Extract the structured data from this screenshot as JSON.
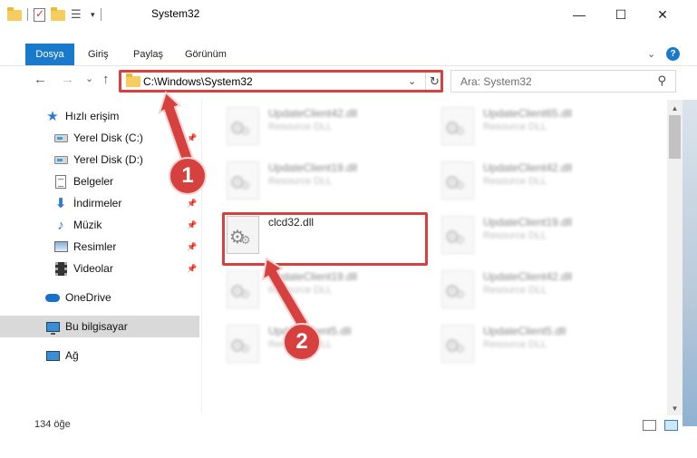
{
  "window": {
    "title": "System32",
    "minimize": "—",
    "maximize": "☐",
    "close": "✕"
  },
  "ribbon": {
    "tabs": [
      "Dosya",
      "Giriş",
      "Paylaş",
      "Görünüm"
    ],
    "help": "?"
  },
  "navigation": {
    "back": "←",
    "forward": "→",
    "recent": "⌄",
    "up": "↑",
    "address": "C:\\Windows\\System32",
    "refresh": "↻",
    "search_placeholder": "Ara: System32"
  },
  "sidebar": {
    "quick_access": "Hızlı erişim",
    "items": [
      {
        "label": "Yerel Disk (C:)",
        "icon": "drive-icon",
        "pinned": true
      },
      {
        "label": "Yerel Disk (D:)",
        "icon": "drive-icon",
        "pinned": false
      },
      {
        "label": "Belgeler",
        "icon": "documents-icon",
        "pinned": true
      },
      {
        "label": "İndirmeler",
        "icon": "downloads-icon",
        "pinned": true
      },
      {
        "label": "Müzik",
        "icon": "music-icon",
        "pinned": true
      },
      {
        "label": "Resimler",
        "icon": "pictures-icon",
        "pinned": true
      },
      {
        "label": "Videolar",
        "icon": "videos-icon",
        "pinned": true
      }
    ],
    "onedrive": "OneDrive",
    "this_pc": "Bu bilgisayar",
    "network": "Ağ"
  },
  "files": {
    "left": [
      {
        "name": "UpdateClient42.dll",
        "type": "Resource DLL",
        "blurred": true
      },
      {
        "name": "UpdateClient19.dll",
        "type": "Resource DLL",
        "blurred": true
      },
      {
        "name": "clcd32.dll",
        "type": "",
        "blurred": false
      },
      {
        "name": "UpdateClient19.dll",
        "type": "Resource DLL",
        "blurred": true
      },
      {
        "name": "UpdateClient5.dll",
        "type": "Resource DLL",
        "blurred": true
      }
    ],
    "right": [
      {
        "name": "UpdateClient65.dll",
        "type": "Resource DLL",
        "blurred": true
      },
      {
        "name": "UpdateClient42.dll",
        "type": "Resource DLL",
        "blurred": true
      },
      {
        "name": "UpdateClient19.dll",
        "type": "Resource DLL",
        "blurred": true
      },
      {
        "name": "UpdateClient42.dll",
        "type": "Resource DLL",
        "blurred": true
      },
      {
        "name": "UpdateClient5.dll",
        "type": "Resource DLL",
        "blurred": true
      }
    ]
  },
  "status": {
    "item_count": "134 öğe"
  },
  "annotations": {
    "step1": "1",
    "step2": "2",
    "color": "#d6413f"
  }
}
